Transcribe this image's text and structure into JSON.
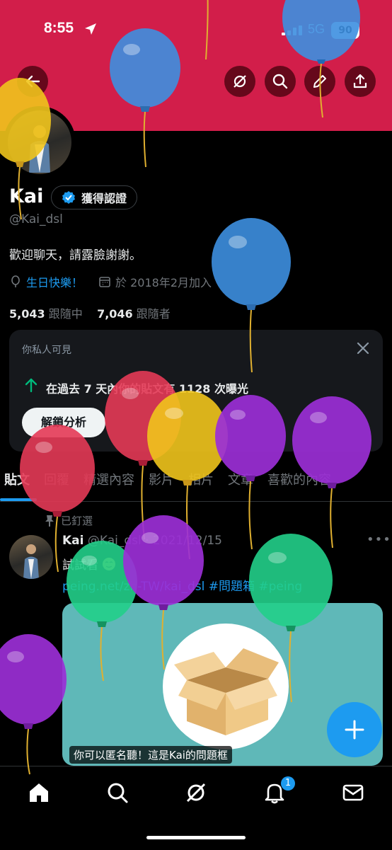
{
  "status_bar": {
    "time": "8:55",
    "network": "5G",
    "battery": "90"
  },
  "header_icons": [
    "back-arrow-icon",
    "grok-icon",
    "search-icon",
    "edit-icon",
    "share-icon"
  ],
  "profile": {
    "name": "Kai",
    "verified_label": "獲得認證",
    "handle": "@Kai_dsl",
    "bio": "歡迎聊天，請露臉謝謝。",
    "birthday": "生日快樂！",
    "joined": "於 2018年2月加入",
    "following_count": "5,043",
    "following_label": "跟隨中",
    "followers_count": "7,046",
    "followers_label": "跟隨者"
  },
  "analytics_card": {
    "title": "你私人可見",
    "text": "在過去 7 天內你的貼文有 1128 次曝光",
    "button": "解鎖分析"
  },
  "tabs": [
    "貼文",
    "回覆",
    "精選內容",
    "影片",
    "相片",
    "文章",
    "喜歡的內容"
  ],
  "post": {
    "pinned": "已釘選",
    "author": "Kai",
    "handle_date": "@Kai_dsl · 2021/12/15",
    "text": "試試看 ",
    "link": "peing.net/zh-TW/kai_dsl #問題箱 #peing",
    "caption": "你可以匿名聽！這是Kai的問題框"
  },
  "bottom_nav": {
    "items": [
      "home-icon",
      "search-icon",
      "grok-icon",
      "notifications-icon",
      "messages-icon"
    ],
    "notification_badge": "1"
  },
  "colors": {
    "banner": "#d21e4a",
    "accent": "#1d9bf0",
    "background": "#000000"
  }
}
